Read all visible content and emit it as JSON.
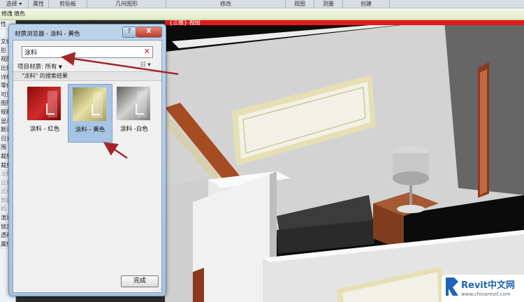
{
  "ribbon": {
    "panels": [
      {
        "label": "选择 ▾",
        "w": 40
      },
      {
        "label": "属性",
        "w": 28
      },
      {
        "label": "剪贴板",
        "w": 54
      },
      {
        "label": "几何图形",
        "w": 112
      },
      {
        "label": "修改",
        "w": 170
      },
      {
        "label": "视图",
        "w": 40
      },
      {
        "label": "测量",
        "w": 40
      },
      {
        "label": "创建",
        "w": 66
      }
    ],
    "context_left": "修改",
    "context_right": "填色"
  },
  "properties": {
    "rows": [
      "性",
      "",
      "文维村",
      "形",
      "视图",
      "比例",
      "详细",
      "零件",
      "可见",
      "图形",
      "规程",
      "显示",
      "默认",
      "日光",
      "围",
      "裁剪",
      "裁剪",
      "注释",
      "远剪",
      "远剪",
      "剖面",
      "机",
      "渲染",
      "锁定",
      "透视",
      "属性帮助"
    ]
  },
  "viewport": {
    "tab_label": "{三维} 视图"
  },
  "dialog": {
    "title": "材质浏览器 - 涂料 - 黄色",
    "help": "?",
    "close": "X",
    "search_value": "涂料",
    "clear_icon": "✕",
    "filter_label": "项目材质: 所有",
    "view_options": "☷ ▾",
    "results_label": "\"涂料\" 的搜索结果",
    "materials": [
      {
        "name": "涂料 - 红色",
        "swatch": "red",
        "selected": false
      },
      {
        "name": "涂料 - 黄色",
        "swatch": "yellow",
        "selected": true
      },
      {
        "name": "涂料 -白色",
        "swatch": "white",
        "selected": false
      }
    ],
    "done": "完成"
  },
  "logo": {
    "brand": "Revit中文网",
    "url": "www.chinarevit.com"
  },
  "colors": {
    "accent": "#e21a1a",
    "selected_tile": "#a8c4e4",
    "arrow": "#a3262b"
  }
}
